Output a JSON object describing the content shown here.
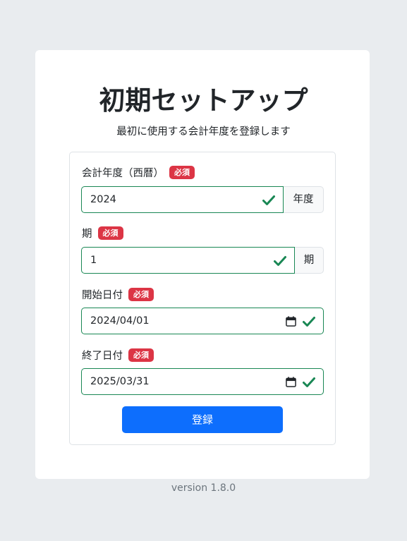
{
  "page": {
    "title": "初期セットアップ",
    "subtitle": "最初に使用する会計年度を登録します",
    "version": "version 1.8.0"
  },
  "form": {
    "required_label": "必須",
    "fiscal_year": {
      "label": "会計年度（西暦）",
      "value": "2024",
      "suffix": "年度"
    },
    "period": {
      "label": "期",
      "value": "1",
      "suffix": "期"
    },
    "start_date": {
      "label": "開始日付",
      "value": "2024/04/01"
    },
    "end_date": {
      "label": "終了日付",
      "value": "2025/03/31"
    },
    "submit_label": "登録"
  },
  "colors": {
    "background": "#e9ecef",
    "valid": "#198754",
    "required_badge": "#dc3545",
    "primary": "#0d6efd"
  },
  "icons": {
    "valid": "check-icon",
    "date_picker": "calendar-icon"
  }
}
